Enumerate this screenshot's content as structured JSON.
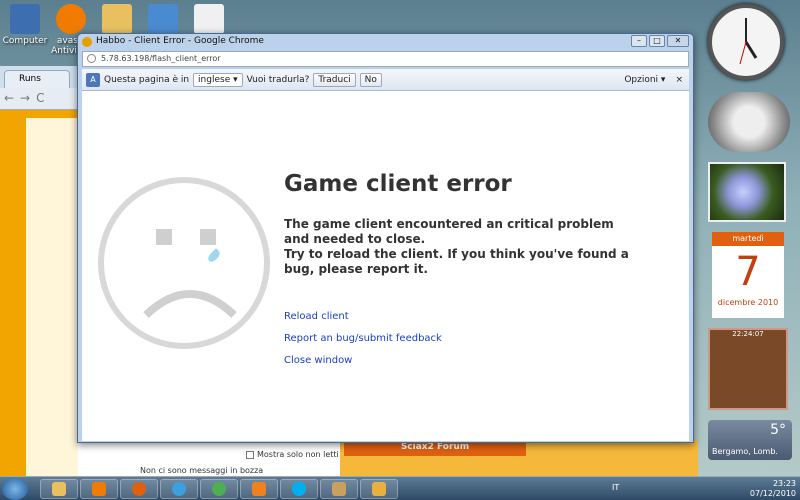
{
  "desktop": {
    "icons": [
      {
        "label": "Computer"
      },
      {
        "label": "avast! Antivirus"
      },
      {
        "label": ""
      },
      {
        "label": ""
      },
      {
        "label": ""
      }
    ]
  },
  "background_browser": {
    "tab_label": "Runs",
    "checkbox_label": "Mostra solo non letti",
    "no_messages": "Non ci sono messaggi in bozza",
    "forum_label": "Sciax2 Forum"
  },
  "window": {
    "title": "Habbo - Client Error - Google Chrome",
    "url": "5.78.63.198/flash_client_error",
    "controls": {
      "minimize": "–",
      "maximize": "□",
      "close": "✕"
    }
  },
  "translate_bar": {
    "prefix": "Questa pagina è in",
    "language": "inglese",
    "question": "Vuoi tradurla?",
    "translate_button": "Traduci",
    "no_button": "No",
    "options": "Opzioni",
    "close": "×"
  },
  "error": {
    "title": "Game client error",
    "message_line1": "The game client encountered an critical problem and needed to close.",
    "message_line2": "Try to reload the client. If you think you've found a bug, please report it.",
    "links": {
      "reload": "Reload client",
      "report": "Report an bug/submit feedback",
      "close": "Close window"
    }
  },
  "gadgets": {
    "calendar": {
      "weekday": "martedì",
      "day": "7",
      "month_year": "dicembre 2010"
    },
    "puzzle_time": "22:24:07",
    "weather": {
      "temp": "5°",
      "city": "Bergamo, Lomb."
    }
  },
  "taskbar": {
    "language": "IT",
    "time": "23:23",
    "date": "07/12/2010"
  },
  "colors": {
    "link": "#1a3ec8",
    "title_text": "#333333",
    "habbo_orange": "#f2a400"
  }
}
